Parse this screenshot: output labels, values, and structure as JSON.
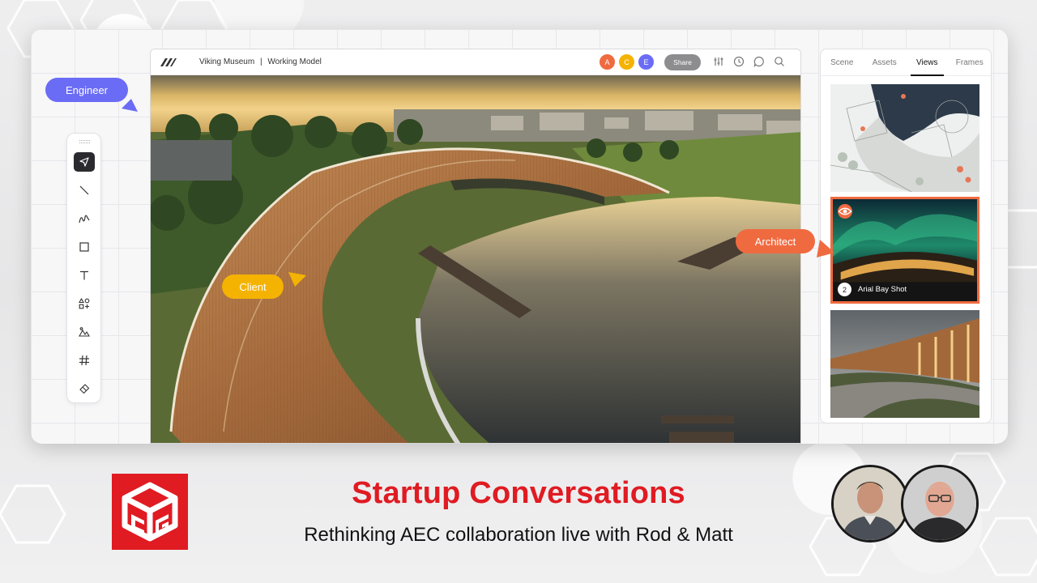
{
  "header": {
    "title": "Viking Museum",
    "separator": "|",
    "subtitle": "Working Model",
    "share_label": "Share",
    "collaborators": [
      {
        "initial": "A",
        "color": "#f06a40"
      },
      {
        "initial": "C",
        "color": "#f5b301"
      },
      {
        "initial": "E",
        "color": "#6b6cf5"
      }
    ]
  },
  "tags": {
    "engineer": {
      "label": "Engineer",
      "color": "#6b6cf5"
    },
    "client": {
      "label": "Client",
      "color": "#f5b301"
    },
    "architect": {
      "label": "Architect",
      "color": "#f06a40"
    }
  },
  "tools": [
    {
      "name": "select-tool",
      "icon": "cursor-arrow-icon",
      "active": true
    },
    {
      "name": "line-tool",
      "icon": "line-icon"
    },
    {
      "name": "pen-tool",
      "icon": "freehand-icon"
    },
    {
      "name": "rectangle-tool",
      "icon": "square-icon"
    },
    {
      "name": "text-tool",
      "icon": "text-icon"
    },
    {
      "name": "shapes-tool",
      "icon": "shapes-icon"
    },
    {
      "name": "image-tool",
      "icon": "landscape-icon"
    },
    {
      "name": "grid-tool",
      "icon": "hash-icon"
    },
    {
      "name": "eraser-tool",
      "icon": "eraser-icon"
    }
  ],
  "panel": {
    "tabs": [
      "Scene",
      "Assets",
      "Views",
      "Frames"
    ],
    "active_tab": "Views",
    "thumbnails": [
      {
        "type": "site-plan"
      },
      {
        "type": "aurora-render",
        "number": "2",
        "label": "Arial Bay Shot",
        "selected": true
      },
      {
        "type": "walkway-render"
      }
    ]
  },
  "footer": {
    "headline": "Startup Conversations",
    "subline": "Rethinking AEC collaboration live with Rod & Matt",
    "accent": "#e01b22"
  }
}
